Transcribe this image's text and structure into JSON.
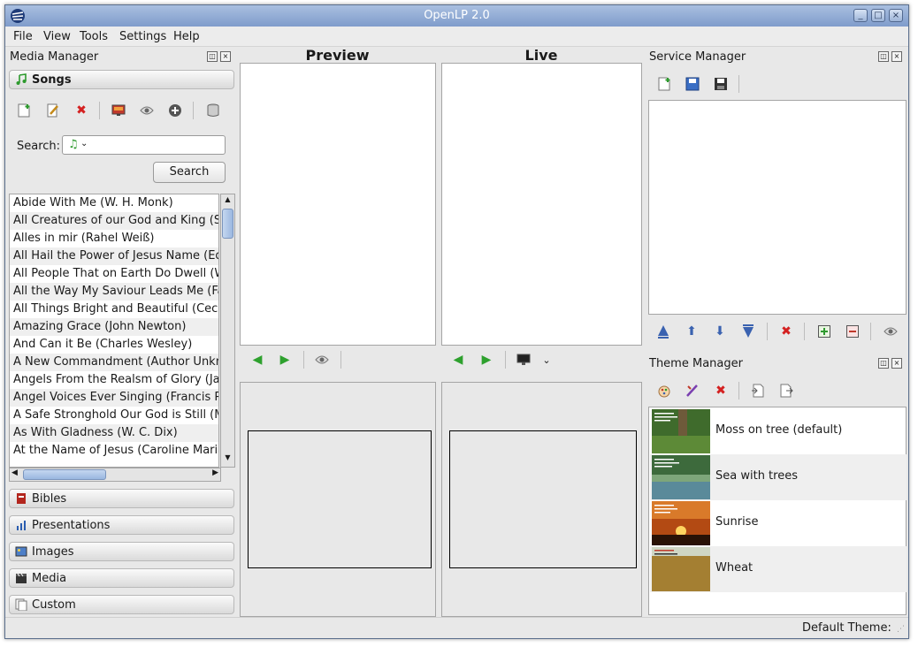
{
  "window": {
    "title": "OpenLP 2.0"
  },
  "menu": [
    "File",
    "View",
    "Tools",
    "Settings",
    "Help"
  ],
  "media_manager": {
    "title": "Media Manager",
    "songs_label": "Songs",
    "search_label": "Search:",
    "search_button": "Search",
    "songs": [
      "Abide With Me (W. H. Monk)",
      "All Creatures of our God and King (St. F",
      "Alles in mir (Rahel Weiß)",
      "All Hail the Power of Jesus Name (Edw",
      "All People That on Earth Do Dwell (Willi",
      "All the Way My Saviour Leads Me (Fann",
      "All Things Bright and Beautiful (Cecil F.",
      "Amazing Grace (John Newton)",
      "And Can it Be (Charles Wesley)",
      "A New Commandment (Author Unknown",
      "Angels From the Realsm of Glory (Jame",
      "Angel Voices Ever Singing (Francis Pott",
      "A Safe Stronghold Our God is Still (Mart",
      "As With Gladness (W. C. Dix)",
      "At the Name of Jesus (Caroline Maria N"
    ],
    "sections": [
      "Bibles",
      "Presentations",
      "Images",
      "Media",
      "Custom"
    ]
  },
  "preview": {
    "title": "Preview"
  },
  "live": {
    "title": "Live"
  },
  "service_manager": {
    "title": "Service Manager"
  },
  "theme_manager": {
    "title": "Theme Manager",
    "themes": [
      "Moss on tree (default)",
      "Sea with trees",
      "Sunrise",
      "Wheat"
    ]
  },
  "status": {
    "default_theme": "Default Theme:"
  },
  "colors": {
    "title_bar": "#8aa6d1",
    "song_icon": "#2e9a2e",
    "delete_icon": "#d42020",
    "nav_arrow": "#2ea12e",
    "service_arrow": "#3a62b0"
  }
}
